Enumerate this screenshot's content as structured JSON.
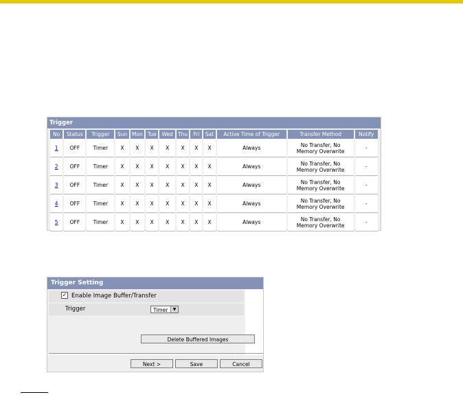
{
  "trigger_table": {
    "title": "Trigger",
    "headers": [
      "No",
      "Status",
      "Trigger",
      "Sun",
      "Mon",
      "Tue",
      "Wed",
      "Thu",
      "Fri",
      "Sat",
      "Active Time of Trigger",
      "Transfer Method",
      "Notify"
    ],
    "rows": [
      {
        "no": "1",
        "status": "OFF",
        "trigger": "Timer",
        "sun": "X",
        "mon": "X",
        "tue": "X",
        "wed": "X",
        "thu": "X",
        "fri": "X",
        "sat": "X",
        "active_time": "Always",
        "transfer_line1": "No Transfer, No",
        "transfer_line2": "Memory Overwrite",
        "notify": "-"
      },
      {
        "no": "2",
        "status": "OFF",
        "trigger": "Timer",
        "sun": "X",
        "mon": "X",
        "tue": "X",
        "wed": "X",
        "thu": "X",
        "fri": "X",
        "sat": "X",
        "active_time": "Always",
        "transfer_line1": "No Transfer, No",
        "transfer_line2": "Memory Overwrite",
        "notify": "-"
      },
      {
        "no": "3",
        "status": "OFF",
        "trigger": "Timer",
        "sun": "X",
        "mon": "X",
        "tue": "X",
        "wed": "X",
        "thu": "X",
        "fri": "X",
        "sat": "X",
        "active_time": "Always",
        "transfer_line1": "No Transfer, No",
        "transfer_line2": "Memory Overwrite",
        "notify": "-"
      },
      {
        "no": "4",
        "status": "OFF",
        "trigger": "Timer",
        "sun": "X",
        "mon": "X",
        "tue": "X",
        "wed": "X",
        "thu": "X",
        "fri": "X",
        "sat": "X",
        "active_time": "Always",
        "transfer_line1": "No Transfer, No",
        "transfer_line2": "Memory Overwrite",
        "notify": "-"
      },
      {
        "no": "5",
        "status": "OFF",
        "trigger": "Timer",
        "sun": "X",
        "mon": "X",
        "tue": "X",
        "wed": "X",
        "thu": "X",
        "fri": "X",
        "sat": "X",
        "active_time": "Always",
        "transfer_line1": "No Transfer, No",
        "transfer_line2": "Memory Overwrite",
        "notify": "-"
      }
    ]
  },
  "trigger_setting": {
    "title": "Trigger Setting",
    "enable_label": "Enable Image Buffer/Transfer",
    "enable_checked": true,
    "trigger_label": "Trigger",
    "trigger_value": "Timer",
    "delete_button": "Delete Buffered Images",
    "next_button": "Next >",
    "save_button": "Save",
    "cancel_button": "Cancel"
  },
  "colors": {
    "header_bg": "#8592b7",
    "panel_bg": "#efefef",
    "top_bar": "#e8c800",
    "link": "#0000cc"
  }
}
